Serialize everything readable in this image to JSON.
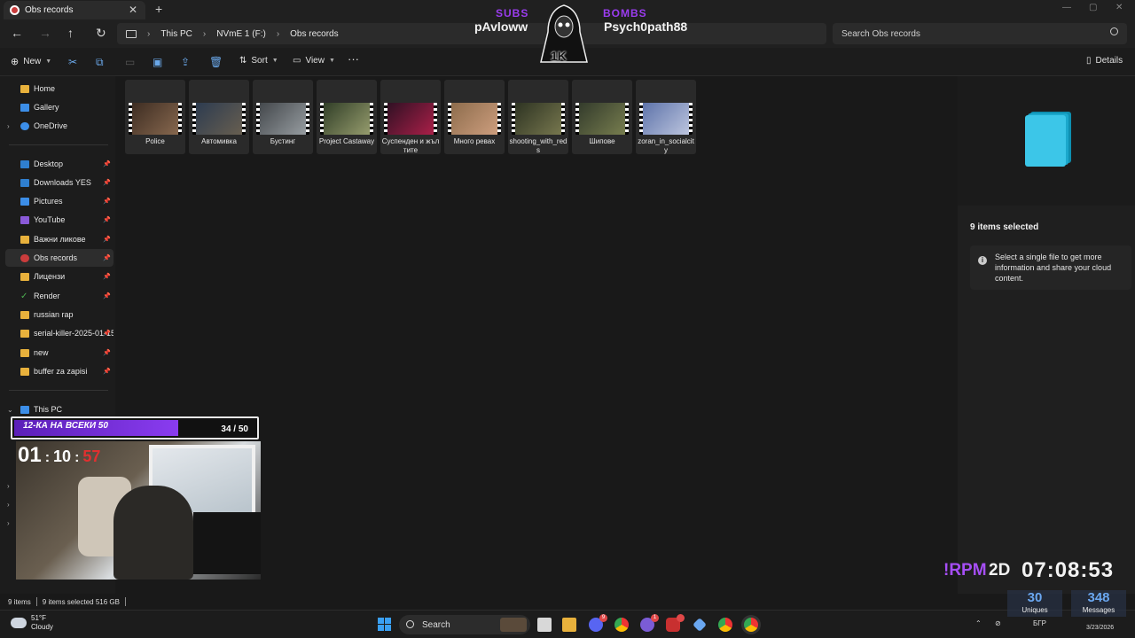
{
  "window": {
    "tab_title": "Obs records",
    "new_tab": "+",
    "close_tab": "✕",
    "minimize": "—",
    "maximize": "▢",
    "close": "✕"
  },
  "nav": {
    "back": "←",
    "forward": "→",
    "up": "↑",
    "refresh": "↻"
  },
  "breadcrumb": [
    "This PC",
    "NVmE 1 (F:)",
    "Obs records"
  ],
  "search": {
    "placeholder": "Search Obs records"
  },
  "toolbar": {
    "new_label": "New",
    "sort_label": "Sort",
    "view_label": "View",
    "more_label": "···",
    "details_label": "Details",
    "icons": [
      "cut-icon",
      "copy-icon",
      "paste-icon",
      "rename-icon",
      "share-icon",
      "delete-icon"
    ]
  },
  "sidebar": {
    "items": [
      {
        "label": "Home",
        "icon": "home-icon",
        "pinned": false
      },
      {
        "label": "Gallery",
        "icon": "gallery-icon",
        "pinned": false
      },
      {
        "label": "OneDrive",
        "icon": "onedrive-icon",
        "pinned": false
      },
      {
        "label": "Desktop",
        "icon": "desktop-icon",
        "pinned": true
      },
      {
        "label": "Downloads YES",
        "icon": "downloads-icon",
        "pinned": true
      },
      {
        "label": "Pictures",
        "icon": "pictures-icon",
        "pinned": true
      },
      {
        "label": "YouTube",
        "icon": "youtube-icon",
        "pinned": true
      },
      {
        "label": "Важни ликове",
        "icon": "folder-icon",
        "pinned": true
      },
      {
        "label": "Obs records",
        "icon": "obs-icon",
        "pinned": true
      },
      {
        "label": "Лицензи",
        "icon": "folder-icon",
        "pinned": true
      },
      {
        "label": "Render",
        "icon": "check-icon",
        "pinned": true
      },
      {
        "label": "russian rap",
        "icon": "folder-icon",
        "pinned": false
      },
      {
        "label": "serial-killer-2025-01-15",
        "icon": "folder-icon",
        "pinned": true
      },
      {
        "label": "new",
        "icon": "folder-icon",
        "pinned": true
      },
      {
        "label": "buffer za zapisi",
        "icon": "folder-icon",
        "pinned": true
      }
    ],
    "this_pc": "This PC"
  },
  "files": [
    {
      "name": "Police",
      "colors": [
        "#3a2a20",
        "#8a6a50"
      ]
    },
    {
      "name": "Автомивка",
      "colors": [
        "#2a3a50",
        "#6a6050"
      ]
    },
    {
      "name": "Бустинг",
      "colors": [
        "#404448",
        "#9aa0a4"
      ]
    },
    {
      "name": "Project Castaway",
      "colors": [
        "#2c3a24",
        "#9aa070"
      ]
    },
    {
      "name": "Суспенден и жълтите",
      "colors": [
        "#2a1022",
        "#b0204a"
      ]
    },
    {
      "name": "Много ревах",
      "colors": [
        "#8a6a4a",
        "#d0a080"
      ]
    },
    {
      "name": "shooting_with_reds",
      "colors": [
        "#2a3020",
        "#7a7a50"
      ]
    },
    {
      "name": "Шипове",
      "colors": [
        "#30382a",
        "#7a8050"
      ]
    },
    {
      "name": "zoran_in_socialcity",
      "colors": [
        "#5a70a8",
        "#c0c8e0"
      ]
    }
  ],
  "details": {
    "title": "9 items selected",
    "info": "Select a single file to get more information and share your cloud content."
  },
  "status": {
    "items": "9 items",
    "selected": "9 items selected  516 GB"
  },
  "taskbar": {
    "weather_temp": "51°F",
    "weather_desc": "Cloudy",
    "search_label": "Search",
    "lang": "БГР",
    "date": "3/23/2026"
  },
  "overlay": {
    "subs_label": "SUBS",
    "subs_name": "pAvloww",
    "bombs_label": "BOMBS",
    "bombs_name": "Psych0path88",
    "mascot_text": "1K",
    "goal_label": "12-КА НА ВСЕКИ 50",
    "goal_count": "34 / 50",
    "goal_progress": 0.68,
    "timer_h": "01",
    "timer_m": "10",
    "timer_s": "57",
    "timer_sep": ":",
    "rpm": "!RPM",
    "mode": "2D",
    "clock": "07:08:53",
    "uniques_value": "30",
    "uniques_label": "Uniques",
    "messages_value": "348",
    "messages_label": "Messages"
  }
}
